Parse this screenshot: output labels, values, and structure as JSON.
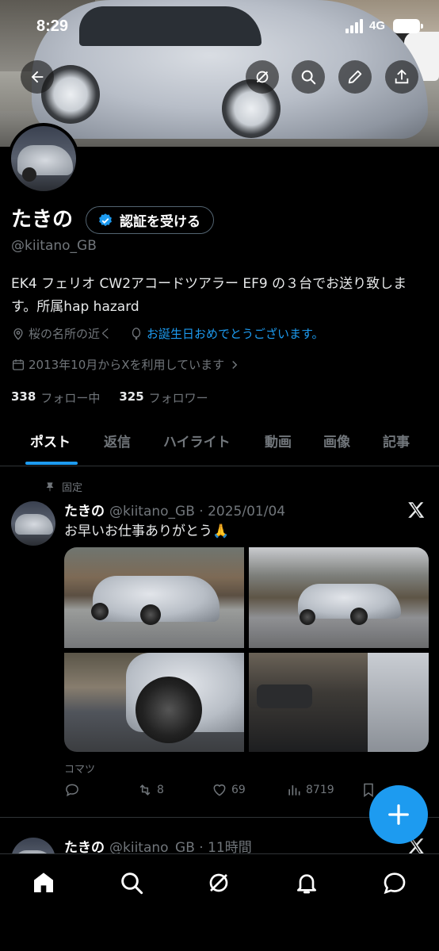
{
  "status_bar": {
    "time": "8:29",
    "network": "4G"
  },
  "profile": {
    "name": "たきの",
    "verify_button_label": "認証を受ける",
    "handle": "@kiitano_GB",
    "bio": "EK4 フェリオ CW2アコードツアラー EF9 の３台でお送り致します。所属hap hazard",
    "location": "桜の名所の近く",
    "birthday_link": "お誕生日おめでとうございます。",
    "joined": "2013年10月からXを利用しています",
    "following_count": "338",
    "following_label": "フォロー中",
    "followers_count": "325",
    "followers_label": "フォロワー"
  },
  "tabs": [
    {
      "label": "ポスト",
      "active": true
    },
    {
      "label": "返信",
      "active": false
    },
    {
      "label": "ハイライト",
      "active": false
    },
    {
      "label": "動画",
      "active": false
    },
    {
      "label": "画像",
      "active": false
    },
    {
      "label": "記事",
      "active": false
    }
  ],
  "posts": [
    {
      "pinned_label": "固定",
      "author": "たきの",
      "meta": "@kiitano_GB · 2025/01/04",
      "text": "お早いお仕事ありがとう🙏",
      "media_caption": "コマツ",
      "retweets": "8",
      "likes": "69",
      "views": "8719"
    },
    {
      "author": "たきの",
      "meta": "@kiitano_GB · 11時間"
    }
  ],
  "icons": {
    "back": "arrow-left-icon",
    "grok": "grok-icon",
    "search": "search-icon",
    "edit": "pencil-icon",
    "share": "share-icon",
    "verified": "verified-badge-icon",
    "location": "location-pin-icon",
    "birthday": "balloon-icon",
    "calendar": "calendar-icon",
    "pin": "pin-icon",
    "reply": "reply-icon",
    "retweet": "retweet-icon",
    "like": "heart-icon",
    "views": "views-icon",
    "bookmark": "bookmark-icon",
    "compose": "plus-icon",
    "home": "home-icon",
    "explore": "search-icon",
    "notifications": "bell-icon",
    "messages": "messages-icon"
  },
  "colors": {
    "accent": "#1d9bf0",
    "background": "#000000",
    "muted_text": "#71767b",
    "primary_text": "#e7e9ea"
  }
}
